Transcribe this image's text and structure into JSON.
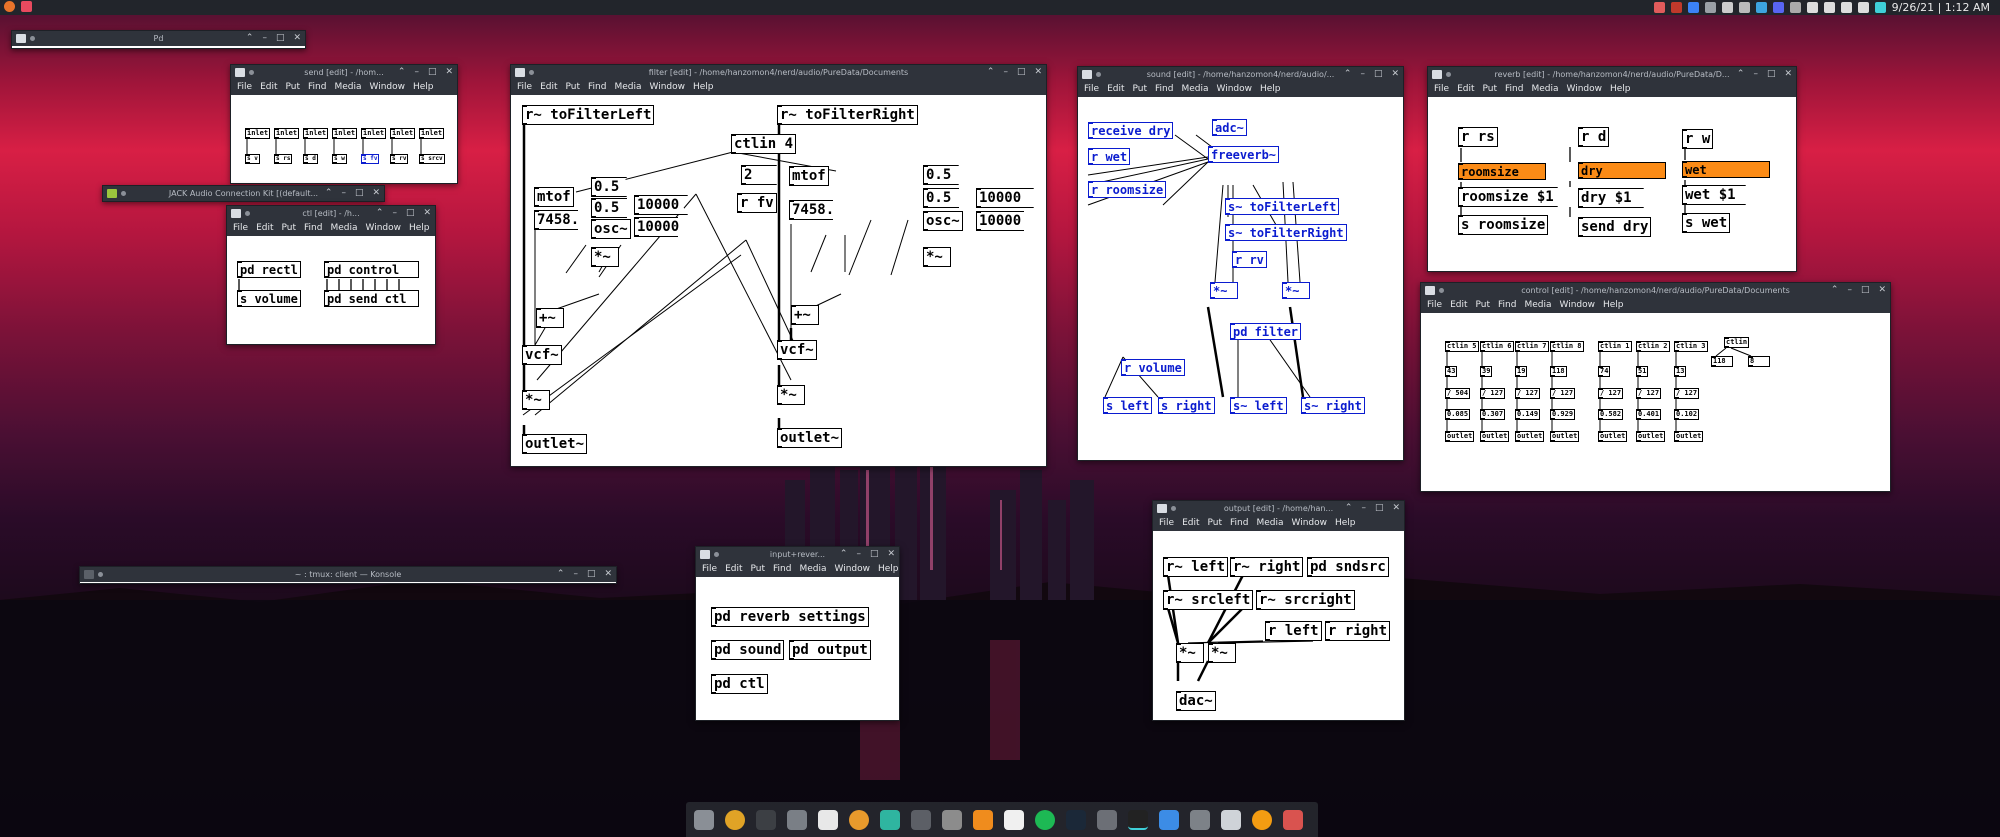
{
  "topbar": {
    "clock": "9/26/21 | 1:12 AM"
  },
  "windows": {
    "pd": {
      "title": "Pd"
    },
    "send": {
      "title": "send [edit] - /hom..."
    },
    "jack": {
      "title": "JACK Audio Connection Kit [(default..."
    },
    "ctl": {
      "title": "ctl [edit] - /h..."
    },
    "filter": {
      "title": "filter [edit] - /home/hanzomon4/nerd/audio/PureData/Documents"
    },
    "sound": {
      "title": "sound [edit] - /home/hanzomon4/nerd/audio/..."
    },
    "reverb": {
      "title": "reverb [edit] - /home/hanzomon4/nerd/audio/PureData/D..."
    },
    "control": {
      "title": "control [edit] - /home/hanzomon4/nerd/audio/PureData/Documents"
    },
    "konsole": {
      "title": "~ : tmux: client — Konsole"
    },
    "input": {
      "title": "input+rever..."
    },
    "output": {
      "title": "output [edit] - /home/han..."
    }
  },
  "menu": {
    "file": "File",
    "edit": "Edit",
    "put": "Put",
    "find": "Find",
    "media": "Media",
    "window": "Window",
    "help": "Help"
  },
  "send_objs": [
    "inlet",
    "inlet",
    "inlet",
    "inlet",
    "inlet",
    "inlet",
    "inlet"
  ],
  "send_objs2": [
    "s v",
    "s rs",
    "s d",
    "s w",
    "s fv",
    "s rv",
    "s srcv"
  ],
  "ctl_objs": {
    "rectl": "pd rectl",
    "control": "pd control",
    "volume": "s volume",
    "sendctl": "pd send ctl"
  },
  "filter_objs": {
    "rleft": "r~ toFilterLeft",
    "rright": "r~ toFilterRight",
    "ctlin": "ctlin 4",
    "two": "2",
    "rfv": "r fv",
    "mtof1": "mtof",
    "mtof2": "mtof",
    "n05a": "0.5",
    "n05b": "0.5",
    "n05c": "0.5",
    "n05d": "0.5",
    "n7458a": "7458.",
    "n7458b": "7458.",
    "n10000a": "10000",
    "n10000b": "10000",
    "n10000c": "10000",
    "n10000d": "10000",
    "osc1": "osc~",
    "osc2": "osc~",
    "mul1": "*~",
    "mul2": "*~",
    "plus1": "+~",
    "plus2": "+~",
    "vcf1": "vcf~",
    "vcf2": "vcf~",
    "mul3": "*~",
    "mul4": "*~",
    "out1": "outlet~",
    "out2": "outlet~"
  },
  "sound_objs": {
    "rdry": "receive dry",
    "adc": "adc~",
    "rwet": "r wet",
    "freeverb": "freeverb~",
    "rroom": "r roomsize",
    "sfl": "s~ toFilterLeft",
    "sfr": "s~ toFilterRight",
    "rrv": "r rv",
    "m1": "*~",
    "m2": "*~",
    "pdfilter": "pd filter",
    "rvol": "r volume",
    "sleft": "s left",
    "sright": "s right",
    "sleft2": "s~ left",
    "sright2": "s~ right"
  },
  "reverb_objs": {
    "rrs": "r rs",
    "rd": "r d",
    "rw": "r w",
    "room": "roomsize",
    "dry": "dry",
    "wet": "wet",
    "rsmsg": "roomsize $1",
    "drymsg": "dry $1",
    "wetmsg": "wet $1",
    "srs": "s roomsize",
    "sdry": "send dry",
    "swet": "s wet"
  },
  "control_objs": {
    "ctlins": [
      "ctlin 5",
      "ctlin 6",
      "ctlin 7",
      "ctlin 8",
      "ctlin 1",
      "ctlin 2",
      "ctlin 3"
    ],
    "vals": [
      "43",
      "39",
      "19",
      "118",
      "74",
      "51",
      "13"
    ],
    "divs": [
      "/ 504",
      "/ 127",
      "/ 127",
      "/ 127",
      "/ 127",
      "/ 127",
      "/ 127"
    ],
    "res": [
      "0.085",
      "0.307",
      "0.149",
      "0.929",
      "0.582",
      "0.401",
      "0.102"
    ],
    "outs": [
      "outlet",
      "outlet",
      "outlet",
      "outlet",
      "outlet",
      "outlet",
      "outlet"
    ],
    "ctlin": "ctlin",
    "v118": "118",
    "v8": "8"
  },
  "input_objs": {
    "rs": "pd reverb settings",
    "sound": "pd sound",
    "output": "pd output",
    "ctl": "pd ctl"
  },
  "output_objs": {
    "rl": "r~ left",
    "rr": "r~ right",
    "snd": "pd sndsrc",
    "rsl": "r~ srcleft",
    "rsr": "r~ srcright",
    "rleft": "r left",
    "rright": "r right",
    "m1": "*~",
    "m2": "*~",
    "dac": "dac~"
  },
  "colors": {
    "accent": "#fb8b16",
    "blue_obj": "#0b1ccf",
    "titlebar": "#2f333b"
  },
  "dock": {
    "icons": [
      "files",
      "chrome",
      "terminal",
      "mic",
      "text-editor",
      "avatar",
      "krita",
      "palette",
      "gimp",
      "blender",
      "pd",
      "spotify",
      "steam",
      "audio",
      "pd-active",
      "screenshot",
      "display",
      "moon",
      "vlc",
      "trash"
    ]
  }
}
